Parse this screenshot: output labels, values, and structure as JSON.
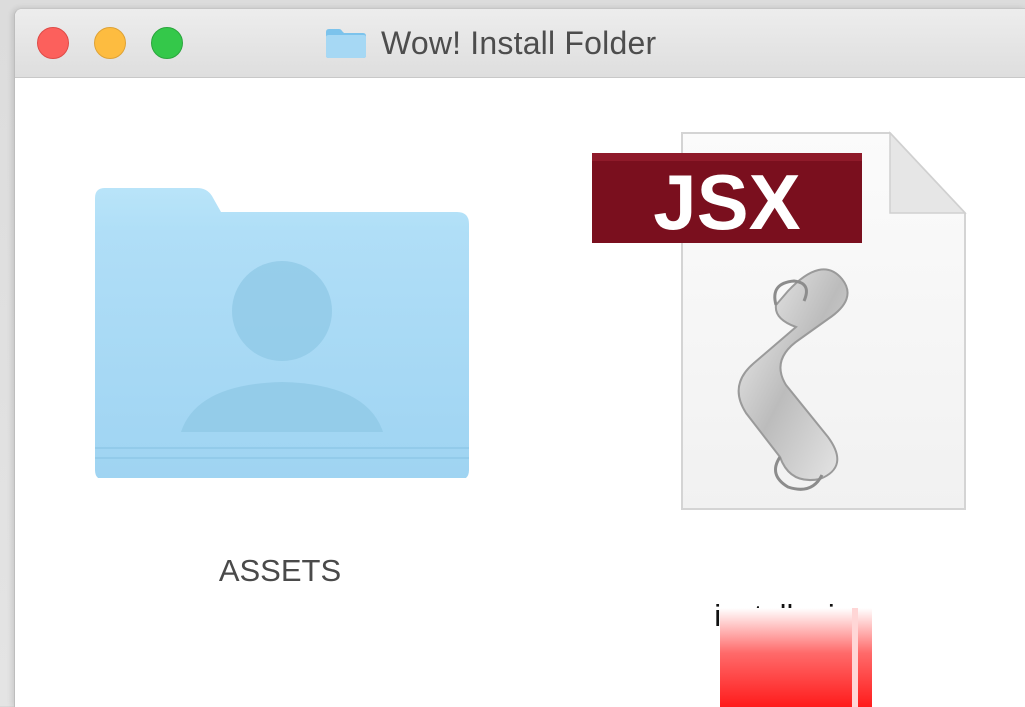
{
  "window": {
    "title": "Wow! Install Folder"
  },
  "titlebar": {
    "buttons": [
      "close",
      "minimize",
      "zoom"
    ],
    "title_icon": "folder-icon"
  },
  "items": [
    {
      "label": "ASSETS",
      "icon": "user-folder-icon",
      "kind": "folder"
    },
    {
      "label": "installer.jsx",
      "icon": "jsx-script-icon",
      "kind": "file",
      "badge": "JSX"
    }
  ],
  "colors": {
    "folder": "#a8dcf6",
    "jsx_badge": "#7a0f1e",
    "close": "#fc605c",
    "minimize": "#fdbc40",
    "zoom": "#34c84a"
  }
}
